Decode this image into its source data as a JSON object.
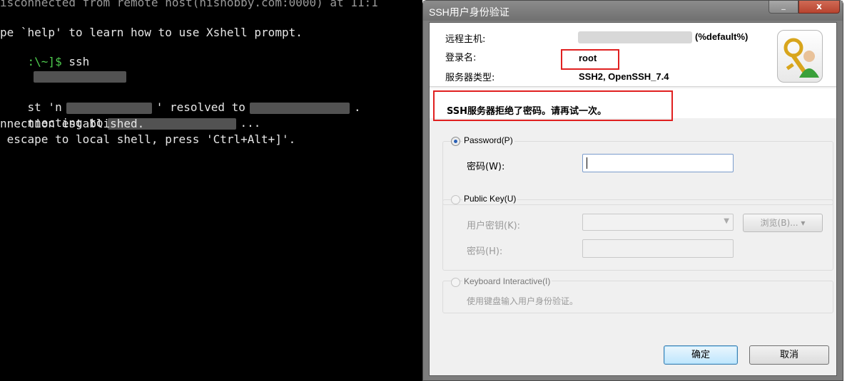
{
  "terminal": {
    "lines": [
      {
        "text": "isconnected from remote host(hisnobby.com:0000) at 11:1"
      },
      {
        "text": "pe `help' to learn how to use Xshell prompt."
      },
      {
        "prompt": ":\\~]$",
        "cmd": " ssh"
      },
      {
        "text_a": "st 'n",
        "text_b": "' resolved to",
        "text_c": "."
      },
      {
        "text_a": "nnecting to",
        "text_b": "..."
      },
      {
        "text": "nnection established."
      },
      {
        "text": " escape to local shell, press 'Ctrl+Alt+]'."
      }
    ]
  },
  "dialog": {
    "title": "SSH用户身份验证",
    "min_glyph": "_",
    "close_glyph": "x",
    "remote_host_label": "远程主机:",
    "remote_host_suffix": "(%default%)",
    "login_label": "登录名:",
    "login_value": "root",
    "server_type_label": "服务器类型:",
    "server_type_value": "SSH2, OpenSSH_7.4",
    "error_message": "SSH服务器拒绝了密码。请再试一次。",
    "password_option": "Password(P)",
    "password_field_label": "密码(W):",
    "password_value": "",
    "publickey_option": "Public Key(U)",
    "user_key_label": "用户密钥(K):",
    "browse_label": "浏览(B)... ▾",
    "passphrase_label": "密码(H):",
    "keyboard_option": "Keyboard Interactive(I)",
    "keyboard_hint": "使用键盘输入用户身份验证。",
    "ok_label": "确定",
    "cancel_label": "取消"
  },
  "colors": {
    "error_border": "#e02020",
    "terminal_bg": "#000000",
    "prompt_green": "#4ecb4e"
  }
}
